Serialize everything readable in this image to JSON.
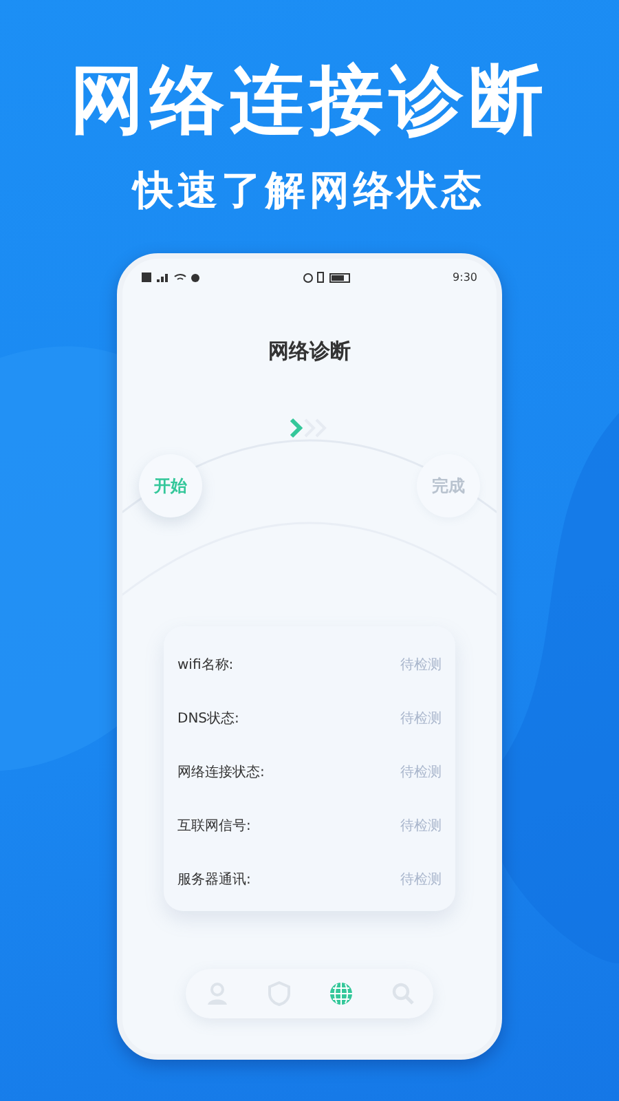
{
  "headline": "网络连接诊断",
  "subheadline": "快速了解网络状态",
  "status_bar": {
    "time": "9:30"
  },
  "screen_title": "网络诊断",
  "progress": [
    {
      "label": "开始",
      "active": true
    },
    {
      "label": "完成",
      "active": false
    }
  ],
  "results": [
    {
      "label": "wifi名称:",
      "value": "待检测"
    },
    {
      "label": "DNS状态:",
      "value": "待检测"
    },
    {
      "label": "网络连接状态:",
      "value": "待检测"
    },
    {
      "label": "互联网信号:",
      "value": "待检测"
    },
    {
      "label": "服务器通讯:",
      "value": "待检测"
    }
  ],
  "nav": [
    {
      "kind": "profile",
      "selected": false
    },
    {
      "kind": "shield",
      "selected": false
    },
    {
      "kind": "globe",
      "selected": true
    },
    {
      "kind": "search",
      "selected": false
    }
  ]
}
